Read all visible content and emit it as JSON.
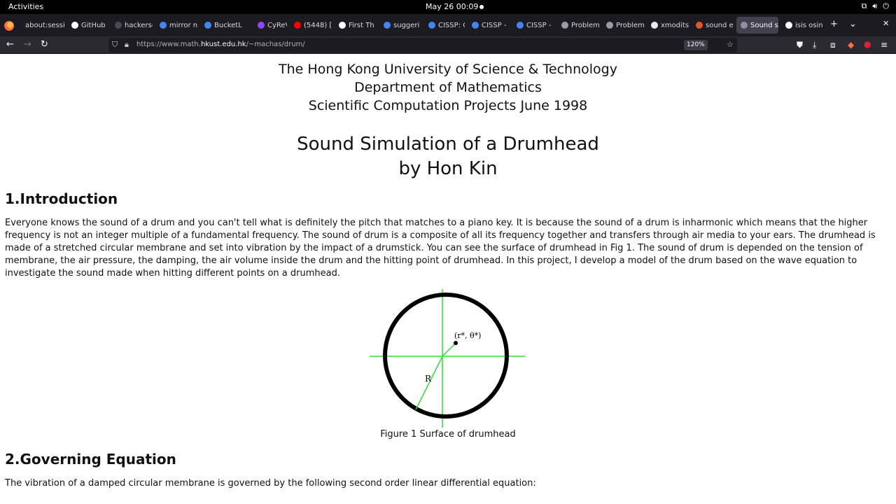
{
  "system": {
    "activities": "Activities",
    "clock": "May 26  00:09"
  },
  "browser": {
    "tabs": [
      {
        "label": "about:sessi",
        "color": "#6e6e78"
      },
      {
        "label": "GitHub",
        "color": "#ffffff"
      },
      {
        "label": "hackerscan",
        "color": "#4a4a55"
      },
      {
        "label": "mirror n",
        "color": "#4285f4"
      },
      {
        "label": "BucketL",
        "color": "#4285f4"
      },
      {
        "label": "CyReVo",
        "color": "#9146ff"
      },
      {
        "label": "(5448) [",
        "color": "#ff0000"
      },
      {
        "label": "First Th",
        "color": "#ffffff"
      },
      {
        "label": "suggeri",
        "color": "#4285f4"
      },
      {
        "label": "CISSP: C",
        "color": "#4285f4"
      },
      {
        "label": "CISSP -",
        "color": "#4285f4"
      },
      {
        "label": "CISSP -",
        "color": "#4285f4"
      },
      {
        "label": "Problem",
        "color": "#9a9aa5"
      },
      {
        "label": "Problem",
        "color": "#9a9aa5"
      },
      {
        "label": "xmodits",
        "color": "#e8e8ef"
      },
      {
        "label": "sound e",
        "color": "#e25525"
      },
      {
        "label": "Sound si",
        "color": "#8f8f9d",
        "active": true
      },
      {
        "label": "isis osin",
        "color": "#ffffff"
      }
    ],
    "close_glyph": "✕",
    "new_tab_glyph": "+",
    "tab_list_glyph": "⌄",
    "url_prefix": "https://www.math.",
    "url_domain": "hkust.edu.hk",
    "url_path": "/~machas/drum/",
    "zoom": "120%"
  },
  "page": {
    "header_lines": [
      "The Hong Kong University of Science & Technology",
      "Department of Mathematics",
      "Scientific Computation Projects June 1998"
    ],
    "title": "Sound Simulation of a Drumhead",
    "author": "by Hon Kin",
    "section1_heading": "1.Introduction",
    "section1_text": "Everyone knows the sound of a drum and you can't tell what is definitely the pitch that matches to a piano key. It is because the sound of a drum is inharmonic which means that the higher frequency is not an integer multiple of a fundamental frequency. The sound of drum is a composite of all its frequency together and transfers through air media to your ears. The drumhead is made of a stretched circular membrane and set into vibration by the impact of a drumstick. You can see the surface of drumhead in Fig 1. The sound of drum is depended on the tension of membrane, the air pressure, the damping, the air volume inside the drum and the hitting point of drumhead. In this project, I develop a model of the drum based on the wave equation to investigate the sound made when hitting different points on a drumhead.",
    "figure_point_label": "(r*, θ*)",
    "figure_radius_label": "R",
    "figure_caption": "Figure 1 Surface of drumhead",
    "section2_heading": "2.Governing Equation",
    "section2_text": "The vibration of a damped circular membrane is governed by the following second order linear differential equation:"
  }
}
